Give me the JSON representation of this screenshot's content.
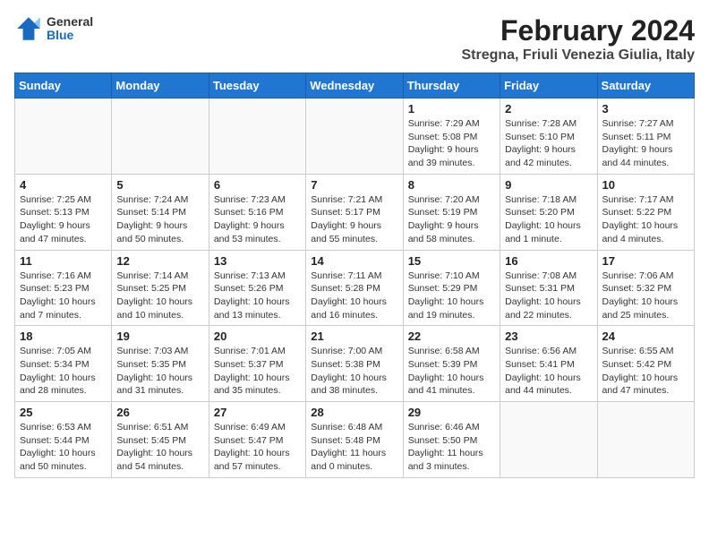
{
  "header": {
    "logo_general": "General",
    "logo_blue": "Blue",
    "month_year": "February 2024",
    "location": "Stregna, Friuli Venezia Giulia, Italy"
  },
  "days_of_week": [
    "Sunday",
    "Monday",
    "Tuesday",
    "Wednesday",
    "Thursday",
    "Friday",
    "Saturday"
  ],
  "weeks": [
    [
      {
        "day": "",
        "info": ""
      },
      {
        "day": "",
        "info": ""
      },
      {
        "day": "",
        "info": ""
      },
      {
        "day": "",
        "info": ""
      },
      {
        "day": "1",
        "info": "Sunrise: 7:29 AM\nSunset: 5:08 PM\nDaylight: 9 hours\nand 39 minutes."
      },
      {
        "day": "2",
        "info": "Sunrise: 7:28 AM\nSunset: 5:10 PM\nDaylight: 9 hours\nand 42 minutes."
      },
      {
        "day": "3",
        "info": "Sunrise: 7:27 AM\nSunset: 5:11 PM\nDaylight: 9 hours\nand 44 minutes."
      }
    ],
    [
      {
        "day": "4",
        "info": "Sunrise: 7:25 AM\nSunset: 5:13 PM\nDaylight: 9 hours\nand 47 minutes."
      },
      {
        "day": "5",
        "info": "Sunrise: 7:24 AM\nSunset: 5:14 PM\nDaylight: 9 hours\nand 50 minutes."
      },
      {
        "day": "6",
        "info": "Sunrise: 7:23 AM\nSunset: 5:16 PM\nDaylight: 9 hours\nand 53 minutes."
      },
      {
        "day": "7",
        "info": "Sunrise: 7:21 AM\nSunset: 5:17 PM\nDaylight: 9 hours\nand 55 minutes."
      },
      {
        "day": "8",
        "info": "Sunrise: 7:20 AM\nSunset: 5:19 PM\nDaylight: 9 hours\nand 58 minutes."
      },
      {
        "day": "9",
        "info": "Sunrise: 7:18 AM\nSunset: 5:20 PM\nDaylight: 10 hours\nand 1 minute."
      },
      {
        "day": "10",
        "info": "Sunrise: 7:17 AM\nSunset: 5:22 PM\nDaylight: 10 hours\nand 4 minutes."
      }
    ],
    [
      {
        "day": "11",
        "info": "Sunrise: 7:16 AM\nSunset: 5:23 PM\nDaylight: 10 hours\nand 7 minutes."
      },
      {
        "day": "12",
        "info": "Sunrise: 7:14 AM\nSunset: 5:25 PM\nDaylight: 10 hours\nand 10 minutes."
      },
      {
        "day": "13",
        "info": "Sunrise: 7:13 AM\nSunset: 5:26 PM\nDaylight: 10 hours\nand 13 minutes."
      },
      {
        "day": "14",
        "info": "Sunrise: 7:11 AM\nSunset: 5:28 PM\nDaylight: 10 hours\nand 16 minutes."
      },
      {
        "day": "15",
        "info": "Sunrise: 7:10 AM\nSunset: 5:29 PM\nDaylight: 10 hours\nand 19 minutes."
      },
      {
        "day": "16",
        "info": "Sunrise: 7:08 AM\nSunset: 5:31 PM\nDaylight: 10 hours\nand 22 minutes."
      },
      {
        "day": "17",
        "info": "Sunrise: 7:06 AM\nSunset: 5:32 PM\nDaylight: 10 hours\nand 25 minutes."
      }
    ],
    [
      {
        "day": "18",
        "info": "Sunrise: 7:05 AM\nSunset: 5:34 PM\nDaylight: 10 hours\nand 28 minutes."
      },
      {
        "day": "19",
        "info": "Sunrise: 7:03 AM\nSunset: 5:35 PM\nDaylight: 10 hours\nand 31 minutes."
      },
      {
        "day": "20",
        "info": "Sunrise: 7:01 AM\nSunset: 5:37 PM\nDaylight: 10 hours\nand 35 minutes."
      },
      {
        "day": "21",
        "info": "Sunrise: 7:00 AM\nSunset: 5:38 PM\nDaylight: 10 hours\nand 38 minutes."
      },
      {
        "day": "22",
        "info": "Sunrise: 6:58 AM\nSunset: 5:39 PM\nDaylight: 10 hours\nand 41 minutes."
      },
      {
        "day": "23",
        "info": "Sunrise: 6:56 AM\nSunset: 5:41 PM\nDaylight: 10 hours\nand 44 minutes."
      },
      {
        "day": "24",
        "info": "Sunrise: 6:55 AM\nSunset: 5:42 PM\nDaylight: 10 hours\nand 47 minutes."
      }
    ],
    [
      {
        "day": "25",
        "info": "Sunrise: 6:53 AM\nSunset: 5:44 PM\nDaylight: 10 hours\nand 50 minutes."
      },
      {
        "day": "26",
        "info": "Sunrise: 6:51 AM\nSunset: 5:45 PM\nDaylight: 10 hours\nand 54 minutes."
      },
      {
        "day": "27",
        "info": "Sunrise: 6:49 AM\nSunset: 5:47 PM\nDaylight: 10 hours\nand 57 minutes."
      },
      {
        "day": "28",
        "info": "Sunrise: 6:48 AM\nSunset: 5:48 PM\nDaylight: 11 hours\nand 0 minutes."
      },
      {
        "day": "29",
        "info": "Sunrise: 6:46 AM\nSunset: 5:50 PM\nDaylight: 11 hours\nand 3 minutes."
      },
      {
        "day": "",
        "info": ""
      },
      {
        "day": "",
        "info": ""
      }
    ]
  ]
}
